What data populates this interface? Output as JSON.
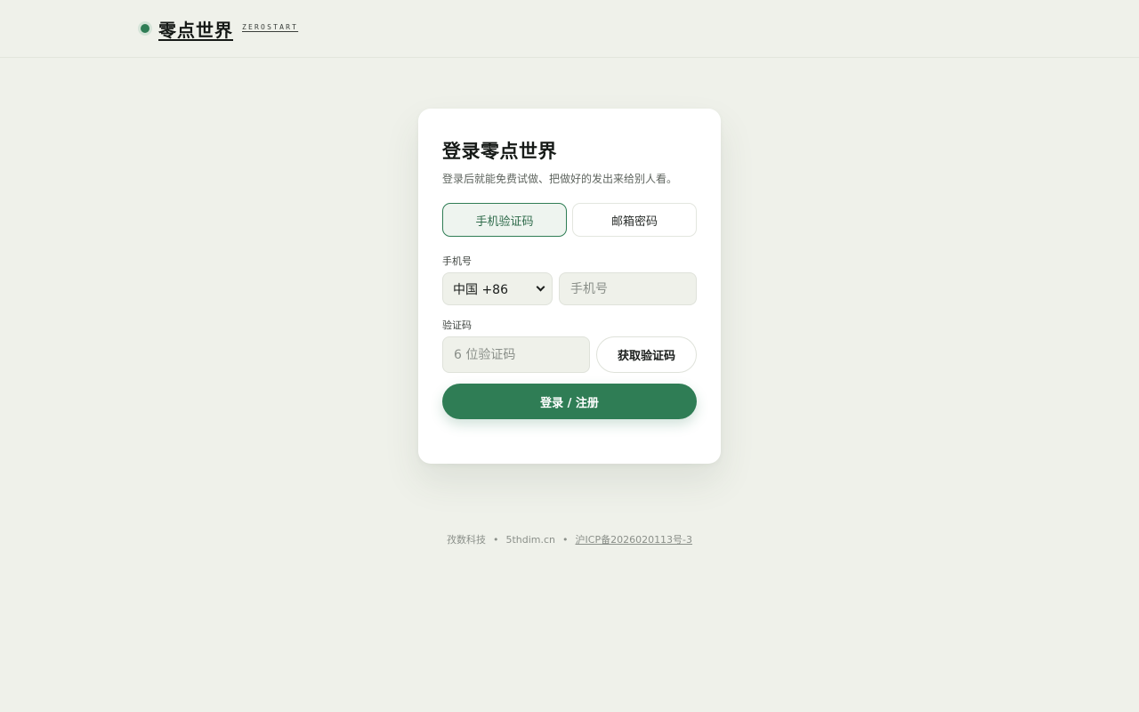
{
  "brand": {
    "name": "零点世界",
    "subtitle": "ZEROSTART"
  },
  "login_card": {
    "title": "登录零点世界",
    "subtitle": "登录后就能免费试做、把做好的发出来给别人看。",
    "tabs": [
      {
        "label": "手机验证码",
        "active": true
      },
      {
        "label": "邮箱密码",
        "active": false
      }
    ],
    "phone_label": "手机号",
    "country_code": "中国 +86",
    "phone_placeholder": "手机号",
    "code_label": "验证码",
    "code_placeholder": "6 位验证码",
    "get_code_label": "获取验证码",
    "submit_label": "登录 / 注册"
  },
  "footer": {
    "company": "孜数科技",
    "separator": "•",
    "domain": "5thdim.cn",
    "icp": "沪ICP备2026020113号-3"
  },
  "colors": {
    "accent": "#2f7d55",
    "background": "#eff1ea",
    "card": "#ffffff"
  }
}
